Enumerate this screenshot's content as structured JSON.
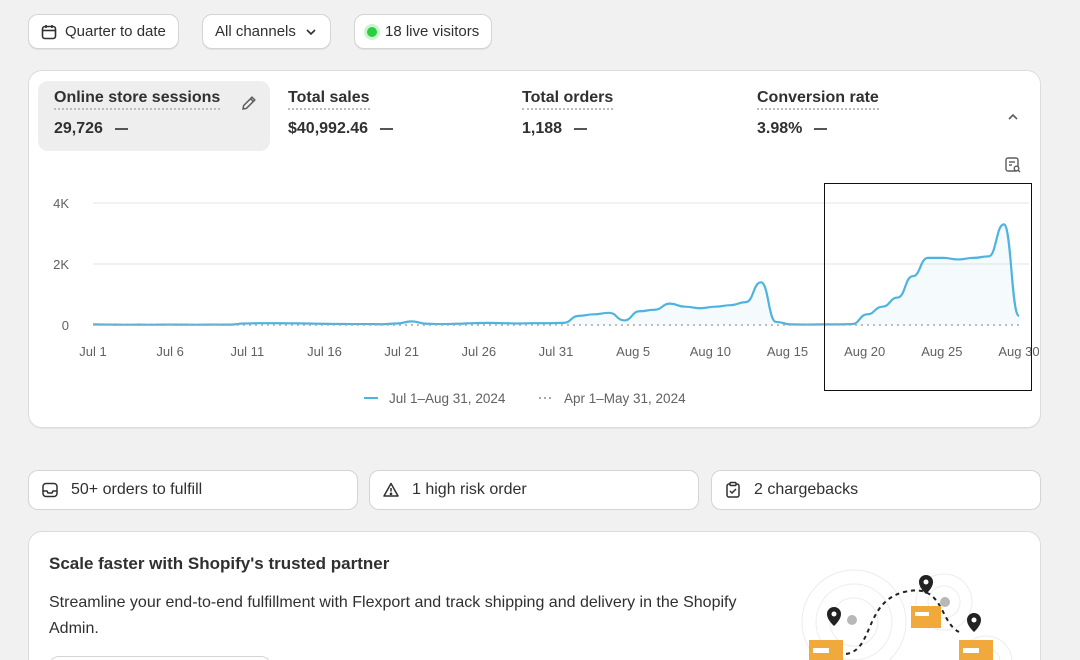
{
  "filters": {
    "date_range": "Quarter to date",
    "channels": "All channels",
    "live_visitors": "18 live visitors"
  },
  "metrics": [
    {
      "label": "Online store sessions",
      "value": "29,726"
    },
    {
      "label": "Total sales",
      "value": "$40,992.46"
    },
    {
      "label": "Total orders",
      "value": "1,188"
    },
    {
      "label": "Conversion rate",
      "value": "3.98%"
    }
  ],
  "chart_data": {
    "type": "line",
    "title": "",
    "xlabel": "",
    "ylabel": "",
    "yticks": [
      "4K",
      "2K",
      "0"
    ],
    "ylim": [
      0,
      4000
    ],
    "xticks": [
      "Jul 1",
      "Jul 6",
      "Jul 11",
      "Jul 16",
      "Jul 21",
      "Jul 26",
      "Jul 31",
      "Aug 5",
      "Aug 10",
      "Aug 15",
      "Aug 20",
      "Aug 25",
      "Aug 30"
    ],
    "grid": true,
    "legend": "bottom",
    "series": [
      {
        "name": "Jul 1–Aug 31, 2024",
        "color": "#4fb3e0",
        "style": "solid",
        "values": [
          20,
          15,
          10,
          12,
          10,
          15,
          12,
          10,
          15,
          12,
          50,
          60,
          60,
          55,
          50,
          40,
          35,
          30,
          30,
          25,
          50,
          120,
          40,
          30,
          40,
          60,
          70,
          60,
          50,
          60,
          60,
          70,
          300,
          350,
          400,
          150,
          450,
          500,
          700,
          600,
          550,
          600,
          650,
          750,
          1400,
          100,
          20,
          15,
          20,
          20,
          30,
          350,
          600,
          900,
          1600,
          2200,
          2200,
          2150,
          2200,
          2250,
          3300,
          300
        ]
      },
      {
        "name": "Apr 1–May 31, 2024",
        "color": "#a8a8a8",
        "style": "dotted",
        "values": [
          0,
          0,
          0,
          0,
          0,
          0,
          0,
          0,
          0,
          0,
          0,
          0,
          0,
          0,
          0,
          0,
          0,
          0,
          0,
          0,
          0,
          0,
          0,
          0,
          0,
          0,
          0,
          0,
          0,
          0,
          0,
          0,
          0,
          0,
          0,
          0,
          0,
          0,
          0,
          0,
          0,
          0,
          0,
          0,
          0,
          0,
          0,
          0,
          0,
          0,
          0,
          0,
          0,
          0,
          0,
          0,
          0,
          0,
          0,
          0,
          0,
          0
        ]
      }
    ]
  },
  "alerts": {
    "orders": "50+ orders to fulfill",
    "risk": "1 high risk order",
    "chargebacks": "2 chargebacks"
  },
  "promo": {
    "title": "Scale faster with Shopify's trusted partner",
    "body": "Streamline your end-to-end fulfillment with Flexport and track shipping and delivery in the Shopify Admin."
  }
}
